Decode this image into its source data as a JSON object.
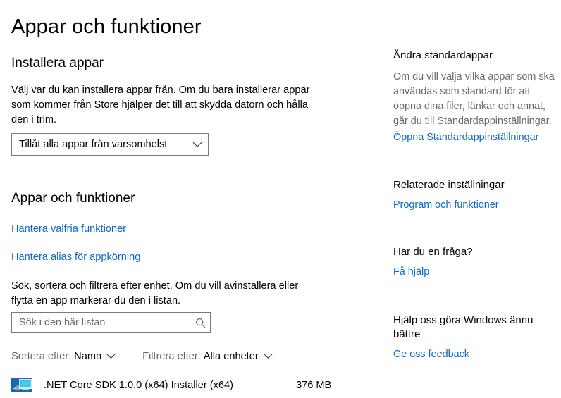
{
  "page": {
    "title": "Appar och funktioner"
  },
  "install_apps": {
    "heading": "Installera appar",
    "description": "Välj var du kan installera appar från. Om du bara installerar appar som kommer från Store hjälper det till att skydda datorn och hålla den i trim.",
    "dropdown": {
      "selected": "Tillåt alla appar från varsomhelst",
      "options": [
        "Tillåt alla appar från varsomhelst"
      ],
      "chevron_icon": "chevron-down-icon"
    }
  },
  "apps_features": {
    "heading": "Appar och funktioner",
    "links": [
      {
        "label": "Hantera valfria funktioner"
      },
      {
        "label": "Hantera alias för appkörning"
      }
    ],
    "description": "Sök, sortera och filtrera efter enhet. Om du vill avinstallera eller flytta en app markerar du den i listan.",
    "search": {
      "placeholder": "Sök i den här listan",
      "value": "",
      "icon": "search-icon"
    },
    "sort": {
      "label": "Sortera efter:",
      "value": "Namn",
      "chevron_icon": "chevron-down-icon"
    },
    "filter": {
      "label": "Filtrera efter:",
      "value": "Alla enheter",
      "chevron_icon": "chevron-down-icon"
    },
    "list": [
      {
        "icon": "installer-package-icon",
        "name": ".NET Core SDK 1.0.0 (x64) Installer (x64)",
        "size": "376 MB"
      }
    ]
  },
  "aside": {
    "default_apps": {
      "heading": "Ändra standardappar",
      "lines": [
        "Om du vill välja vilka appar som ska",
        "användas som standard för att",
        "öppna dina filer, länkar och annat,",
        "går du till Standardappinställningar."
      ],
      "link": "Öppna Standardappinställningar"
    },
    "related": {
      "heading": "Relaterade inställningar",
      "link": "Program och funktioner"
    },
    "question": {
      "heading": "Har du en fråga?",
      "link": "Få hjälp"
    },
    "feedback": {
      "heading_line1": "Hjälp oss göra Windows ännu",
      "heading_line2": "bättre",
      "link": "Ge oss feedback"
    }
  },
  "colors": {
    "link": "#0b68ca",
    "body_text": "#000000",
    "muted_text": "#6b6b6b",
    "border": "#7a7a7a",
    "background": "#ffffff"
  }
}
